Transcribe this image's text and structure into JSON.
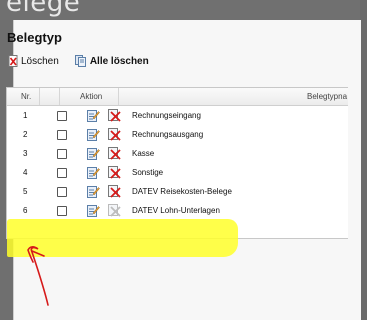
{
  "window": {
    "title": "elege"
  },
  "panel": {
    "title": "Belegtyp",
    "toolbar": {
      "delete_label": "Löschen",
      "delete_all_label": "Alle löschen"
    }
  },
  "table": {
    "headers": {
      "nr": "Nr.",
      "aktion": "Aktion",
      "belegtypname": "Belegtypna"
    },
    "rows": [
      {
        "nr": "1",
        "name": "Rechnungseingang",
        "delete_enabled": true
      },
      {
        "nr": "2",
        "name": "Rechnungsausgang",
        "delete_enabled": true
      },
      {
        "nr": "3",
        "name": "Kasse",
        "delete_enabled": true
      },
      {
        "nr": "4",
        "name": "Sonstige",
        "delete_enabled": true
      },
      {
        "nr": "5",
        "name": "DATEV Reisekosten-Belege",
        "delete_enabled": true
      },
      {
        "nr": "6",
        "name": "DATEV Lohn-Unterlagen",
        "delete_enabled": false
      }
    ]
  },
  "annotation": {
    "highlight_color": "#ffff2a",
    "arrow_color": "#d61a1a"
  },
  "colors": {
    "delete_red": "#d61a1a",
    "edit_blue": "#3b6fb0"
  }
}
